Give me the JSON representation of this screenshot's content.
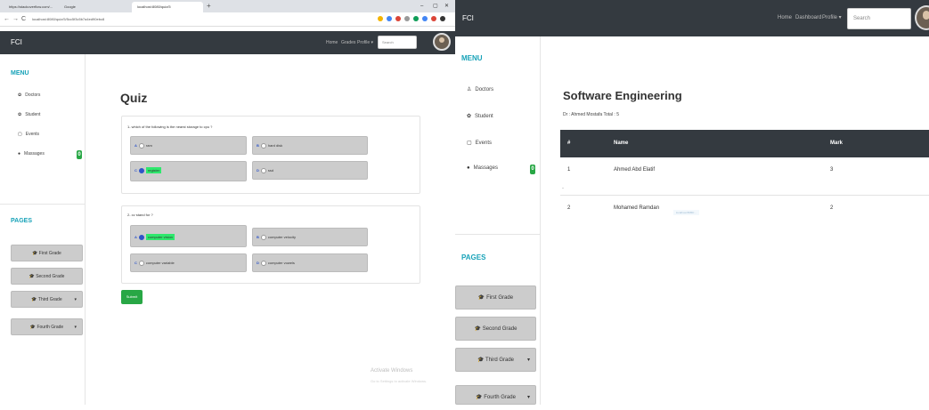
{
  "browser": {
    "tabs": [
      {
        "title": "https://stackoverflow.com/..."
      },
      {
        "title": "Google"
      },
      {
        "title": "localhost:8080/quiz/5"
      }
    ],
    "new_tab": "+",
    "window_controls": {
      "minimize": "–",
      "maximize": "▢",
      "close": "✕"
    },
    "nav": {
      "back": "←",
      "forward": "→",
      "reload": "C"
    },
    "url": "localhost:8080/quiz/5/5cc5f3c5b7a4ed90ebc8"
  },
  "left": {
    "brand": "FCI",
    "nav": {
      "home": "Home",
      "grades": "Grades",
      "profile": "Profile ▾"
    },
    "search_placeholder": "Search",
    "menu_title": "MENU",
    "menu": [
      {
        "icon": "doctor-icon",
        "label": "Doctors"
      },
      {
        "icon": "student-icon",
        "label": "Student"
      },
      {
        "icon": "calendar-icon",
        "label": "Events"
      },
      {
        "icon": "chat-icon",
        "label": "Massages",
        "badge": "0"
      }
    ],
    "pages_title": "PAGES",
    "pages": [
      {
        "label": "First Grade",
        "caret": ""
      },
      {
        "label": "Second Grade",
        "caret": ""
      },
      {
        "label": "Third Grade",
        "caret": "▾"
      },
      {
        "label": "Fourth Grade",
        "caret": "▾"
      }
    ],
    "quiz_title": "Quiz",
    "questions": [
      {
        "text": "1- which of the following is the nearst storage to cpu ?",
        "options": [
          {
            "letter": "A",
            "text": "ram",
            "selected": false
          },
          {
            "letter": "B",
            "text": "hard disk",
            "selected": false
          },
          {
            "letter": "C",
            "text": "register",
            "selected": true
          },
          {
            "letter": "D",
            "text": "ssd",
            "selected": false
          }
        ]
      },
      {
        "text": "2- cv stand for ?",
        "options": [
          {
            "letter": "A",
            "text": "computer vision",
            "selected": true
          },
          {
            "letter": "B",
            "text": "computer velocity",
            "selected": false
          },
          {
            "letter": "C",
            "text": "computer variable",
            "selected": false
          },
          {
            "letter": "D",
            "text": "computer vowels",
            "selected": false
          }
        ]
      }
    ],
    "submit_label": "Submit",
    "activate_title": "Activate Windows",
    "activate_sub": "Go to Settings to activate Windows."
  },
  "right": {
    "brand": "FCI",
    "nav": {
      "home": "Home",
      "dashboard": "Dashboard",
      "profile": "Profile ▾"
    },
    "search_placeholder": "Search",
    "menu_title": "MENU",
    "menu": [
      {
        "icon": "doctor-icon",
        "label": "Doctors"
      },
      {
        "icon": "student-icon",
        "label": "Student"
      },
      {
        "icon": "calendar-icon",
        "label": "Events"
      },
      {
        "icon": "chat-icon",
        "label": "Massages",
        "badge": "0"
      }
    ],
    "pages_title": "PAGES",
    "pages": [
      {
        "label": "First Grade",
        "caret": ""
      },
      {
        "label": "Second Grade",
        "caret": ""
      },
      {
        "label": "Third Grade",
        "caret": "▾"
      },
      {
        "label": "Fourth Grade",
        "caret": "▾"
      }
    ],
    "course_title": "Software Engineering",
    "course_sub": "Dr : Ahmed Mostafa   Total : 5",
    "table": {
      "headers": [
        "#",
        "Name",
        "Mark"
      ],
      "rows": [
        {
          "num": "1",
          "name": "Ahmed Abd Elatif",
          "mark": "3"
        },
        {
          "num": "2",
          "name": "Mohamed Ramdan",
          "mark": "2"
        }
      ],
      "separator": "-",
      "ghost_text": "localhost:8080/..."
    }
  },
  "colors": {
    "navbar": "#343a40",
    "accent": "#17a2b8",
    "success": "#28a745",
    "highlight": "#2ee86d"
  }
}
